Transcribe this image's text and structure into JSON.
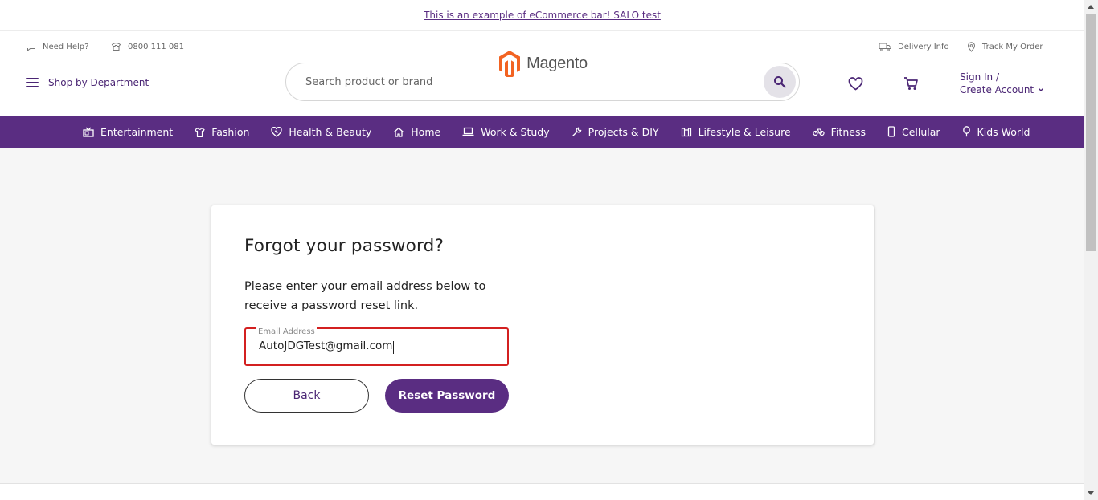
{
  "promo": {
    "text": "This is an example of eCommerce bar! SALO test"
  },
  "header": {
    "need_help": "Need Help?",
    "phone": "0800 111 081",
    "delivery_info": "Delivery Info",
    "track_order": "Track My Order",
    "shop_by_department": "Shop by Department",
    "search_placeholder": "Search product or brand",
    "logo_text": "Magento",
    "sign_in": "Sign In /",
    "create_account": "Create Account"
  },
  "nav": {
    "items": [
      {
        "label": "Entertainment",
        "icon": "tv-icon"
      },
      {
        "label": "Fashion",
        "icon": "shirt-icon"
      },
      {
        "label": "Health & Beauty",
        "icon": "heart-pulse-icon"
      },
      {
        "label": "Home",
        "icon": "home-icon"
      },
      {
        "label": "Work & Study",
        "icon": "laptop-icon"
      },
      {
        "label": "Projects & DIY",
        "icon": "wrench-icon"
      },
      {
        "label": "Lifestyle & Leisure",
        "icon": "book-icon"
      },
      {
        "label": "Fitness",
        "icon": "bicycle-icon"
      },
      {
        "label": "Cellular",
        "icon": "phone-icon"
      },
      {
        "label": "Kids World",
        "icon": "balloon-icon"
      }
    ]
  },
  "form": {
    "title": "Forgot your password?",
    "description": "Please enter your email address below to receive a password reset link.",
    "email_label": "Email Address",
    "email_value": "AutoJDGTest@gmail.com",
    "back_label": "Back",
    "reset_label": "Reset Password"
  },
  "colors": {
    "brand_purple": "#5a2d82",
    "error_red": "#d32020",
    "logo_orange": "#f26322"
  }
}
